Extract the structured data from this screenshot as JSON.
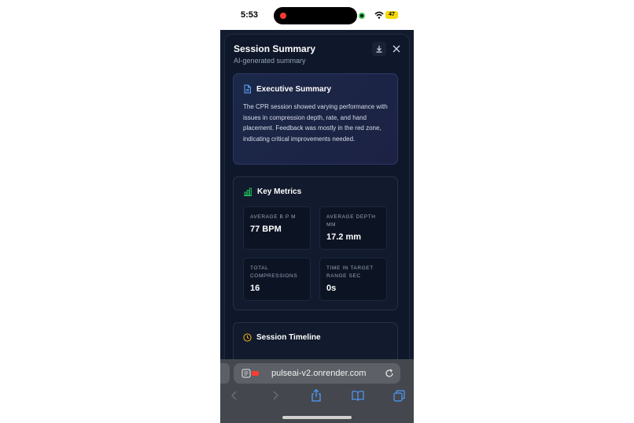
{
  "status_bar": {
    "time": "5:53",
    "battery": "47"
  },
  "modal": {
    "title": "Session Summary",
    "subtitle": "AI-generated summary"
  },
  "executive_summary": {
    "title": "Executive Summary",
    "text": "The CPR session showed varying performance with issues in compression depth, rate, and hand placement. Feedback was mostly in the red zone, indicating critical improvements needed."
  },
  "key_metrics": {
    "title": "Key Metrics",
    "items": [
      {
        "label": "AVERAGE B P M",
        "value": "77 BPM"
      },
      {
        "label": "AVERAGE DEPTH MM",
        "value": "17.2 mm"
      },
      {
        "label": "TOTAL COMPRESSIONS",
        "value": "16"
      },
      {
        "label": "TIME IN TARGET RANGE SEC",
        "value": "0s"
      }
    ]
  },
  "session_timeline": {
    "title": "Session Timeline"
  },
  "browser": {
    "url": "pulseai-v2.onrender.com"
  },
  "colors": {
    "modal_bg": "#0f172a",
    "doc_icon": "#60a5fa",
    "chart_icon": "#22c55e",
    "clock_icon": "#f5b400",
    "toolbar_active": "#4d9bff"
  },
  "icons": [
    "document-icon",
    "bar-chart-icon",
    "clock-icon",
    "download-icon",
    "close-icon",
    "reader-icon",
    "reload-icon",
    "back-icon",
    "forward-icon",
    "share-icon",
    "bookmarks-icon",
    "tabs-icon",
    "wifi-icon"
  ]
}
